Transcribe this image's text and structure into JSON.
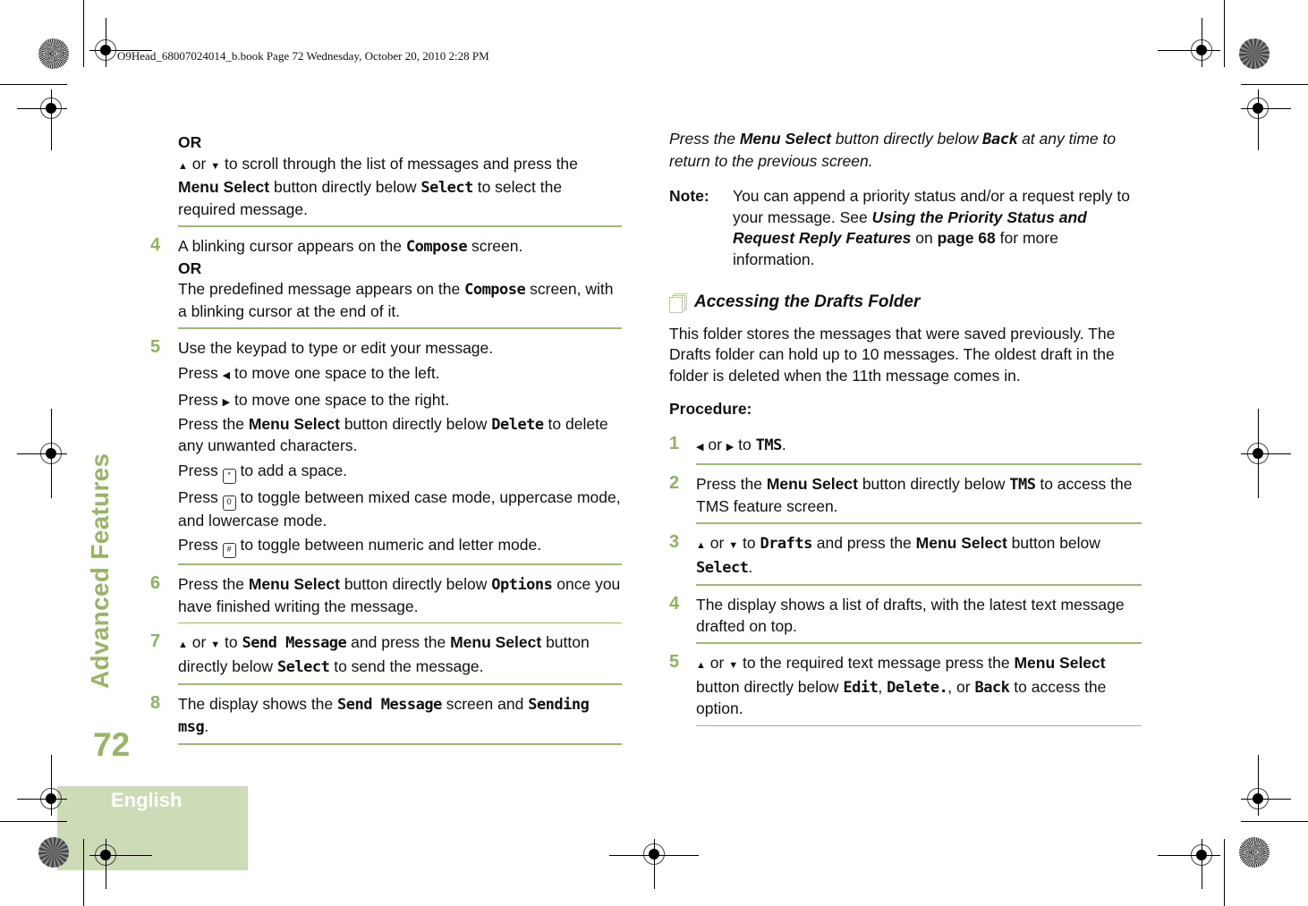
{
  "header": {
    "book_info": "O9Head_68007024014_b.book  Page 72  Wednesday, October 20, 2010  2:28 PM"
  },
  "sidebar": {
    "section_title": "Advanced Features",
    "page_number": "72",
    "language": "English"
  },
  "left_column": {
    "intro": {
      "or": "OR",
      "up_down": "or",
      "text1": "to scroll through the list of messages and press the",
      "menu_select": "Menu Select",
      "text2": "button directly below",
      "lcd_select": "Select",
      "text3": "to select the required message."
    },
    "steps": [
      {
        "num": "4",
        "text1": "A blinking cursor appears on the",
        "lcd": "Compose",
        "text2": "screen.",
        "or": "OR",
        "text3": "The predefined message appears on the",
        "lcd2": "Compose",
        "text4": "screen, with a blinking cursor at the end of it."
      },
      {
        "num": "5",
        "lines": {
          "l1": "Use the keypad to type or edit your message.",
          "press": "Press",
          "left": "to move one space to the left.",
          "right": "to move one space to the right.",
          "press_the": "Press the",
          "menu_select": "Menu Select",
          "below": "button directly below",
          "lcd_delete": "Delete",
          "delete_rest": "to delete any unwanted characters.",
          "star_text": "to add a space.",
          "zero_text": "to toggle between mixed case mode, uppercase mode, and lowercase mode.",
          "hash_text": "to toggle between numeric and letter mode."
        }
      },
      {
        "num": "6",
        "text1": "Press the",
        "menu_select": "Menu Select",
        "text2": "button directly below",
        "lcd": "Options",
        "text3": "once you have finished writing the message."
      },
      {
        "num": "7",
        "or": "or",
        "to": "to",
        "lcd": "Send Message",
        "text1": "and press the",
        "menu_select": "Menu Select",
        "text2": "button directly below",
        "lcd2": "Select",
        "text3": "to send the message."
      },
      {
        "num": "8",
        "text1": "The display shows the",
        "lcd": "Send Message",
        "text2": "screen and",
        "lcd2": "Sending msg",
        "text3": "."
      }
    ]
  },
  "right_column": {
    "tip": {
      "text1": "Press the",
      "menu_select": "Menu Select",
      "text2": "button directly below",
      "lcd_back": "Back",
      "text3": "at any time to return to the previous screen."
    },
    "note": {
      "label": "Note:",
      "text1": "You can append a priority status and/or a request reply to your message. See",
      "link": "Using the Priority Status and Request Reply Features",
      "text2": "on",
      "page_ref": "page 68",
      "text3": "for more information."
    },
    "section_title": "Accessing the Drafts Folder",
    "description": "This folder stores the messages that were saved previously. The Drafts folder can hold up to 10 messages. The oldest draft in the folder is deleted when the 11th message comes in.",
    "procedure_label": "Procedure:",
    "steps": [
      {
        "num": "1",
        "or": "or",
        "to": "to",
        "lcd": "TMS",
        "end": "."
      },
      {
        "num": "2",
        "text1": "Press the",
        "menu_select": "Menu Select",
        "text2": "button directly below",
        "lcd": "TMS",
        "text3": "to access the TMS feature screen."
      },
      {
        "num": "3",
        "or": "or",
        "to": "to",
        "lcd": "Drafts",
        "text1": "and press the",
        "menu_select": "Menu Select",
        "text2": "button below",
        "lcd2": "Select",
        "end": "."
      },
      {
        "num": "4",
        "text1": "The display shows a list of drafts, with the latest text message drafted on top."
      },
      {
        "num": "5",
        "or": "or",
        "text1": "to the required text message press the",
        "menu_select": "Menu Select",
        "text2": "button directly below",
        "lcd1": "Edit",
        "comma": ",",
        "lcd2": "Delete.",
        "or2": ", or",
        "lcd3": "Back",
        "text3": "to access the option."
      }
    ]
  },
  "colors": {
    "accent_green": "#97b566",
    "rule_green": "#9dba6e",
    "lang_box": "#cddcb7"
  },
  "icons": {
    "up": "▲",
    "down": "▼",
    "left": "◀",
    "right": "▶",
    "star_key": "*",
    "zero_key": "0",
    "hash_key": "#"
  }
}
